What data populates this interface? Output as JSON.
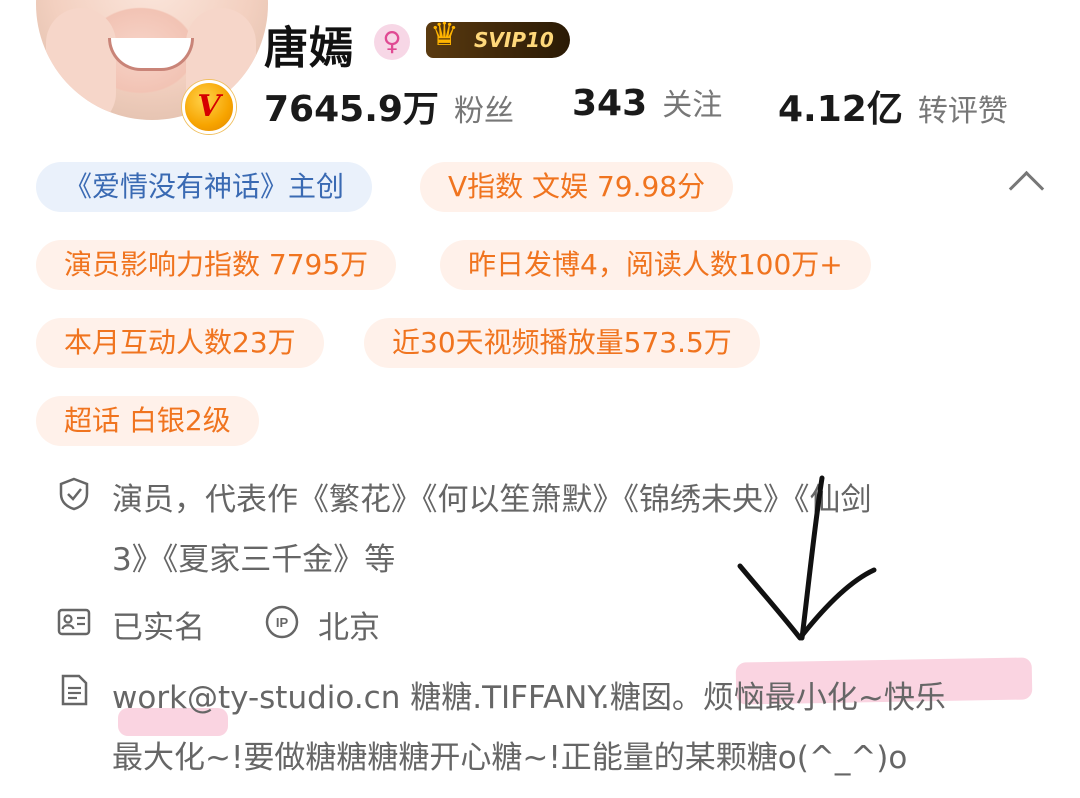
{
  "profile": {
    "name": "唐嫣",
    "gender_icon": "female-icon",
    "vip_label": "SVIP10",
    "verified_badge": "V"
  },
  "stats": [
    {
      "value": "7645.9万",
      "label": "粉丝"
    },
    {
      "value": "343",
      "label": "关注"
    },
    {
      "value": "4.12亿",
      "label": "转评赞"
    }
  ],
  "tags": [
    "《爱情没有神话》主创",
    "V指数 文娱 79.98分",
    "演员影响力指数 7795万",
    "昨日发博4，阅读人数100万+",
    "本月互动人数23万",
    "近30天视频播放量573.5万",
    "超话 白银2级"
  ],
  "info": {
    "verification_line1": "演员，代表作《繁花》《何以笙箫默》《锦绣未央》《仙剑",
    "verification_line2": "3》《夏家三千金》等",
    "real_name": "已实名",
    "ip_label": "IP",
    "location": "北京",
    "bio_line1_a": "work@ty-studio.cn 糖糖.TIFFANY.糖囡。",
    "bio_line1_b": "烦恼最小化~快乐",
    "bio_line2": "最大化~!要做糖糖糖糖开心糖~!正能量的某颗糖o(^_^)o"
  },
  "colors": {
    "tag_blue_bg": "#eaf1fb",
    "tag_blue_text": "#3a6ab3",
    "tag_orange_bg": "#fff1ea",
    "tag_orange_text": "#f0741f",
    "highlight": "#f6b0c8"
  }
}
